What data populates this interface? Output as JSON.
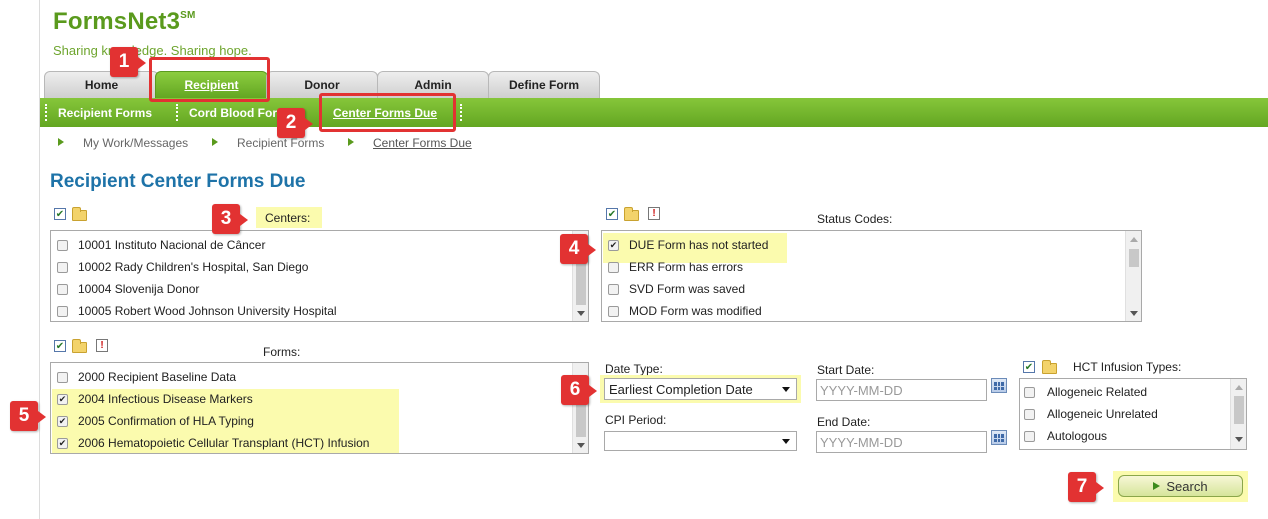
{
  "header": {
    "app_title": "FormsNet3",
    "app_title_mark": "SM",
    "tagline": "Sharing knowledge. Sharing hope."
  },
  "tabs": [
    {
      "label": "Home"
    },
    {
      "label": "Recipient",
      "active": true
    },
    {
      "label": "Donor"
    },
    {
      "label": "Admin"
    },
    {
      "label": "Define Form"
    }
  ],
  "subnav": [
    {
      "label": "Recipient Forms"
    },
    {
      "label": "Cord Blood Forms"
    },
    {
      "label": "Center Forms Due",
      "active": true
    }
  ],
  "breadcrumb": [
    "My Work/Messages",
    "Recipient Forms",
    "Center Forms Due"
  ],
  "page_title": "Recipient Center Forms Due",
  "centers": {
    "label": "Centers:",
    "items": [
      {
        "text": "10001 Instituto Nacional de Câncer",
        "checked": false
      },
      {
        "text": "10002 Rady Children's Hospital, San Diego",
        "checked": false
      },
      {
        "text": "10004 Slovenija Donor",
        "checked": false
      },
      {
        "text": "10005 Robert Wood Johnson University Hospital",
        "checked": false
      }
    ]
  },
  "status_codes": {
    "label": "Status Codes:",
    "items": [
      {
        "text": "DUE Form has not started",
        "checked": true
      },
      {
        "text": "ERR Form has errors",
        "checked": false
      },
      {
        "text": "SVD Form was saved",
        "checked": false
      },
      {
        "text": "MOD Form was modified",
        "checked": false
      }
    ]
  },
  "forms": {
    "label": "Forms:",
    "items": [
      {
        "text": "2000 Recipient Baseline Data",
        "checked": false
      },
      {
        "text": "2004 Infectious Disease Markers",
        "checked": true
      },
      {
        "text": "2005 Confirmation of HLA Typing",
        "checked": true
      },
      {
        "text": "2006 Hematopoietic Cellular Transplant (HCT) Infusion",
        "checked": true
      }
    ]
  },
  "date_type": {
    "label": "Date Type:",
    "value": "Earliest Completion Date"
  },
  "cpi_period": {
    "label": "CPI Period:",
    "value": ""
  },
  "start_date": {
    "label": "Start Date:",
    "placeholder": "YYYY-MM-DD"
  },
  "end_date": {
    "label": "End Date:",
    "placeholder": "YYYY-MM-DD"
  },
  "hct": {
    "label": "HCT Infusion Types:",
    "items": [
      {
        "text": "Allogeneic Related",
        "checked": false
      },
      {
        "text": "Allogeneic Unrelated",
        "checked": false
      },
      {
        "text": "Autologous",
        "checked": false
      }
    ]
  },
  "search_label": "Search",
  "callouts": [
    "1",
    "2",
    "3",
    "4",
    "5",
    "6",
    "7"
  ],
  "colors": {
    "brand_green": "#63a622",
    "title_blue": "#1e73a8",
    "callout_red": "#e23232",
    "highlight": "#fafaa0"
  }
}
